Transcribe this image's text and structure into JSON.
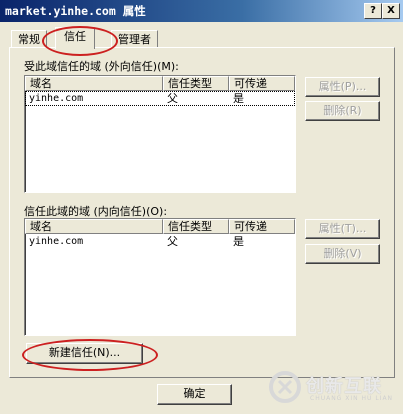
{
  "window": {
    "title": "market.yinhe.com 属性",
    "help_btn": "?",
    "close_btn": "X"
  },
  "tabs": [
    {
      "label": "常规"
    },
    {
      "label": "信任"
    },
    {
      "label": "管理者"
    }
  ],
  "outgoing": {
    "label": "受此域信任的域 (外向信任)(M):",
    "columns": [
      "域名",
      "信任类型",
      "可传递"
    ],
    "rows": [
      {
        "name": "yinhe.com",
        "type": "父",
        "transitive": "是"
      }
    ],
    "properties_btn": "属性(P)...",
    "remove_btn": "删除(R)"
  },
  "incoming": {
    "label": "信任此域的域 (内向信任)(O):",
    "columns": [
      "域名",
      "信任类型",
      "可传递"
    ],
    "rows": [
      {
        "name": "yinhe.com",
        "type": "父",
        "transitive": "是"
      }
    ],
    "properties_btn": "属性(T)...",
    "remove_btn": "删除(V)"
  },
  "new_trust_btn": "新建信任(N)...",
  "ok_btn": "确定",
  "watermark": {
    "text": "创新互联",
    "subtext": "CHUANG XIN HU LIAN"
  },
  "colors": {
    "face": "#ece9d8",
    "title_start": "#0a246a",
    "highlight_ring": "#cc2020"
  }
}
